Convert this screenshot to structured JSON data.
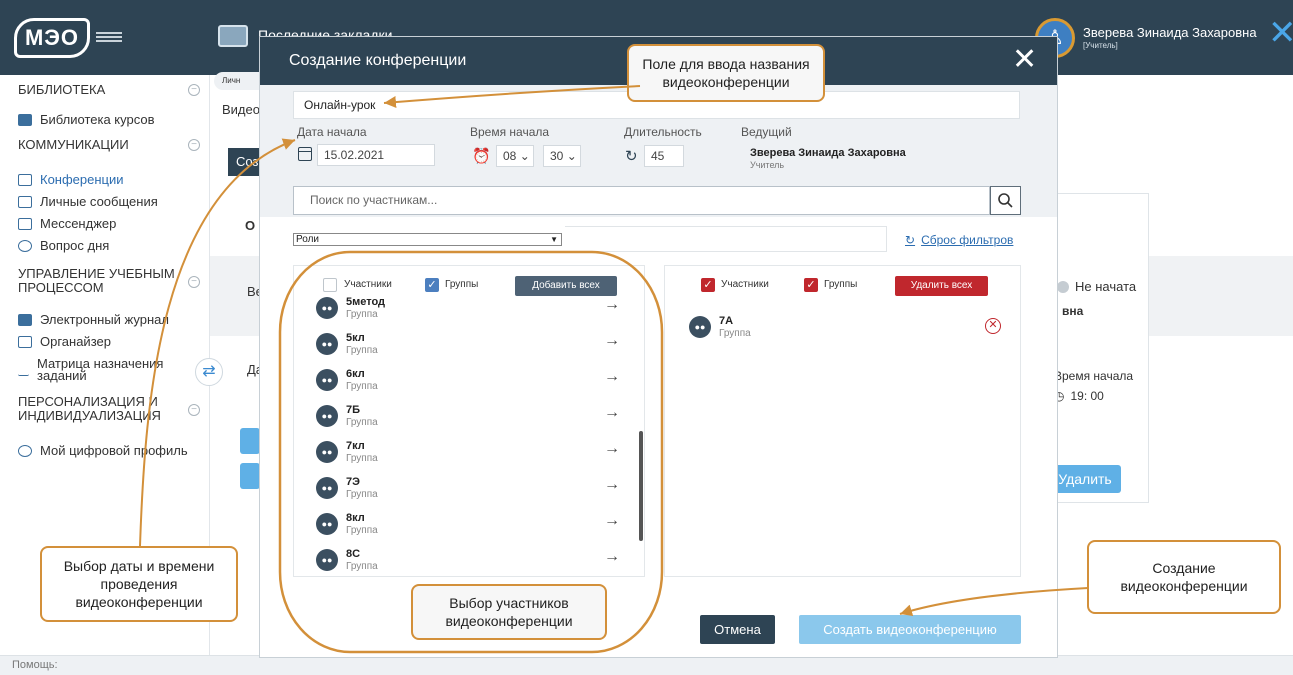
{
  "app": {
    "logo": "МЭО",
    "top_title": "Последние закладки",
    "user_name": "Зверева Зинаида Захаровна",
    "user_role": "[Учитель]",
    "close_icon": "close-icon"
  },
  "sidebar": {
    "sections": [
      {
        "label": "БИБЛИОТЕКА",
        "items": [
          {
            "label": "Библиотека курсов",
            "icon": "book-icon"
          }
        ]
      },
      {
        "label": "КОММУНИКАЦИИ",
        "items": [
          {
            "label": "Конференции",
            "icon": "video-icon",
            "active": true
          },
          {
            "label": "Личные сообщения",
            "icon": "mail-icon"
          },
          {
            "label": "Мессенджер",
            "icon": "chat-icon"
          },
          {
            "label": "Вопрос дня",
            "icon": "question-icon"
          }
        ]
      },
      {
        "label": "УПРАВЛЕНИЕ УЧЕБНЫМ ПРОЦЕССОМ",
        "items": [
          {
            "label": "Электронный журнал",
            "icon": "journal-icon"
          },
          {
            "label": "Органайзер",
            "icon": "calendar-icon"
          },
          {
            "label": "Матрица назначения заданий",
            "icon": "trend-icon"
          }
        ]
      },
      {
        "label": "ПЕРСОНАЛИЗАЦИЯ И ИНДИВИДУАЛИЗАЦИЯ",
        "items": [
          {
            "label": "Мой цифровой профиль",
            "icon": "user-icon"
          }
        ]
      }
    ]
  },
  "background": {
    "crumb": "Личн",
    "video_label": "Видео",
    "create_btn_frag": "Соз",
    "card_title_frag": "О",
    "ve_frag": "Ве",
    "da_frag": "Да",
    "status": "Не начата",
    "host_frag": "вна",
    "time_label": "Время начала",
    "time_value": "19: 00",
    "delete_btn": "Удалить"
  },
  "footer": {
    "help": "Помощь:"
  },
  "modal": {
    "title": "Создание конференции",
    "name_value": "Онлайн-урок",
    "date_label": "Дата начала",
    "date_value": "15.02.2021",
    "time_label": "Время начала",
    "hour": "08",
    "minute": "30",
    "duration_label": "Длительность",
    "duration_value": "45",
    "host_label": "Ведущий",
    "host_name": "Зверева Зинаида Захаровна",
    "host_role": "Учитель",
    "search_placeholder": "Поиск по участникам...",
    "roles_select": "Роли",
    "reset_filters": "Сброс фильтров",
    "left": {
      "participants": "Участники",
      "groups": "Группы",
      "add_all": "Добавить всех",
      "list": [
        {
          "name": "5метод",
          "type": "Группа"
        },
        {
          "name": "5кл",
          "type": "Группа"
        },
        {
          "name": "6кл",
          "type": "Группа"
        },
        {
          "name": "7Б",
          "type": "Группа"
        },
        {
          "name": "7кл",
          "type": "Группа"
        },
        {
          "name": "7Э",
          "type": "Группа"
        },
        {
          "name": "8кл",
          "type": "Группа"
        },
        {
          "name": "8С",
          "type": "Группа"
        }
      ]
    },
    "right": {
      "participants": "Участники",
      "groups": "Группы",
      "delete_all": "Удалить всех",
      "list": [
        {
          "name": "7А",
          "type": "Группа"
        }
      ]
    },
    "cancel": "Отмена",
    "create": "Создать видеоконференцию"
  },
  "callouts": {
    "name_field": "Поле для ввода названия видеоконференции",
    "date_time": "Выбор даты и времени проведения видеоконференции",
    "participants": "Выбор участников видеоконференции",
    "create": "Создание видеоконференции"
  },
  "colors": {
    "accent": "#d3903a",
    "header": "#2e4454",
    "link": "#2b6cb0",
    "danger": "#c0272d"
  }
}
